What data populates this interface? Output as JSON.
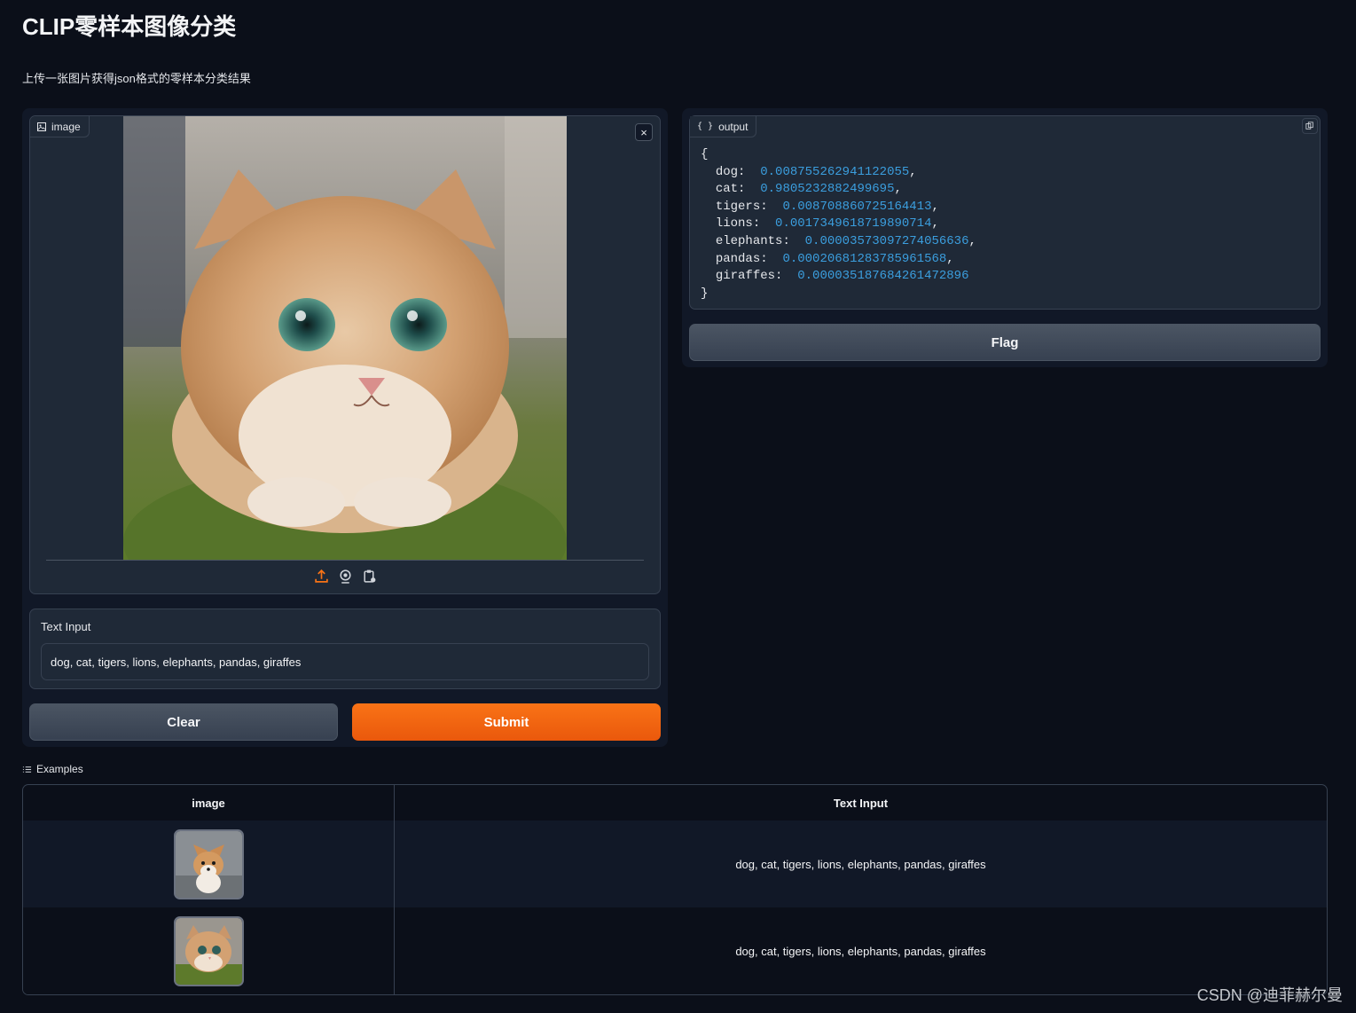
{
  "page": {
    "title": "CLIP零样本图像分类",
    "description": "上传一张图片获得json格式的零样本分类结果"
  },
  "image_input": {
    "label": "image",
    "close_icon": "close-icon",
    "source_icons": [
      "upload-icon",
      "webcam-icon",
      "clipboard-icon"
    ]
  },
  "text_input": {
    "label": "Text Input",
    "value": "dog, cat, tigers, lions, elephants, pandas, giraffes"
  },
  "buttons": {
    "clear": "Clear",
    "submit": "Submit",
    "flag": "Flag"
  },
  "output": {
    "label": "output",
    "open_brace": "{",
    "close_brace": "}",
    "entries": [
      {
        "key": "dog",
        "value": "0.008755262941122055"
      },
      {
        "key": "cat",
        "value": "0.9805232882499695"
      },
      {
        "key": "tigers",
        "value": "0.008708860725164413"
      },
      {
        "key": "lions",
        "value": "0.0017349618719890714"
      },
      {
        "key": "elephants",
        "value": "0.00003573097274056636"
      },
      {
        "key": "pandas",
        "value": "0.00020681283785961568"
      },
      {
        "key": "giraffes",
        "value": "0.000035187684261472896"
      }
    ]
  },
  "examples": {
    "label": "Examples",
    "headers": [
      "image",
      "Text Input"
    ],
    "rows": [
      {
        "image": "corgi-thumbnail",
        "text": "dog, cat, tigers, lions, elephants, pandas, giraffes"
      },
      {
        "image": "cat-thumbnail",
        "text": "dog, cat, tigers, lions, elephants, pandas, giraffes"
      }
    ]
  },
  "watermark": "CSDN @迪菲赫尔曼",
  "colors": {
    "background": "#0b0f19",
    "panel": "#1f2937",
    "accent": "#f97316",
    "number": "#3b9ede"
  }
}
